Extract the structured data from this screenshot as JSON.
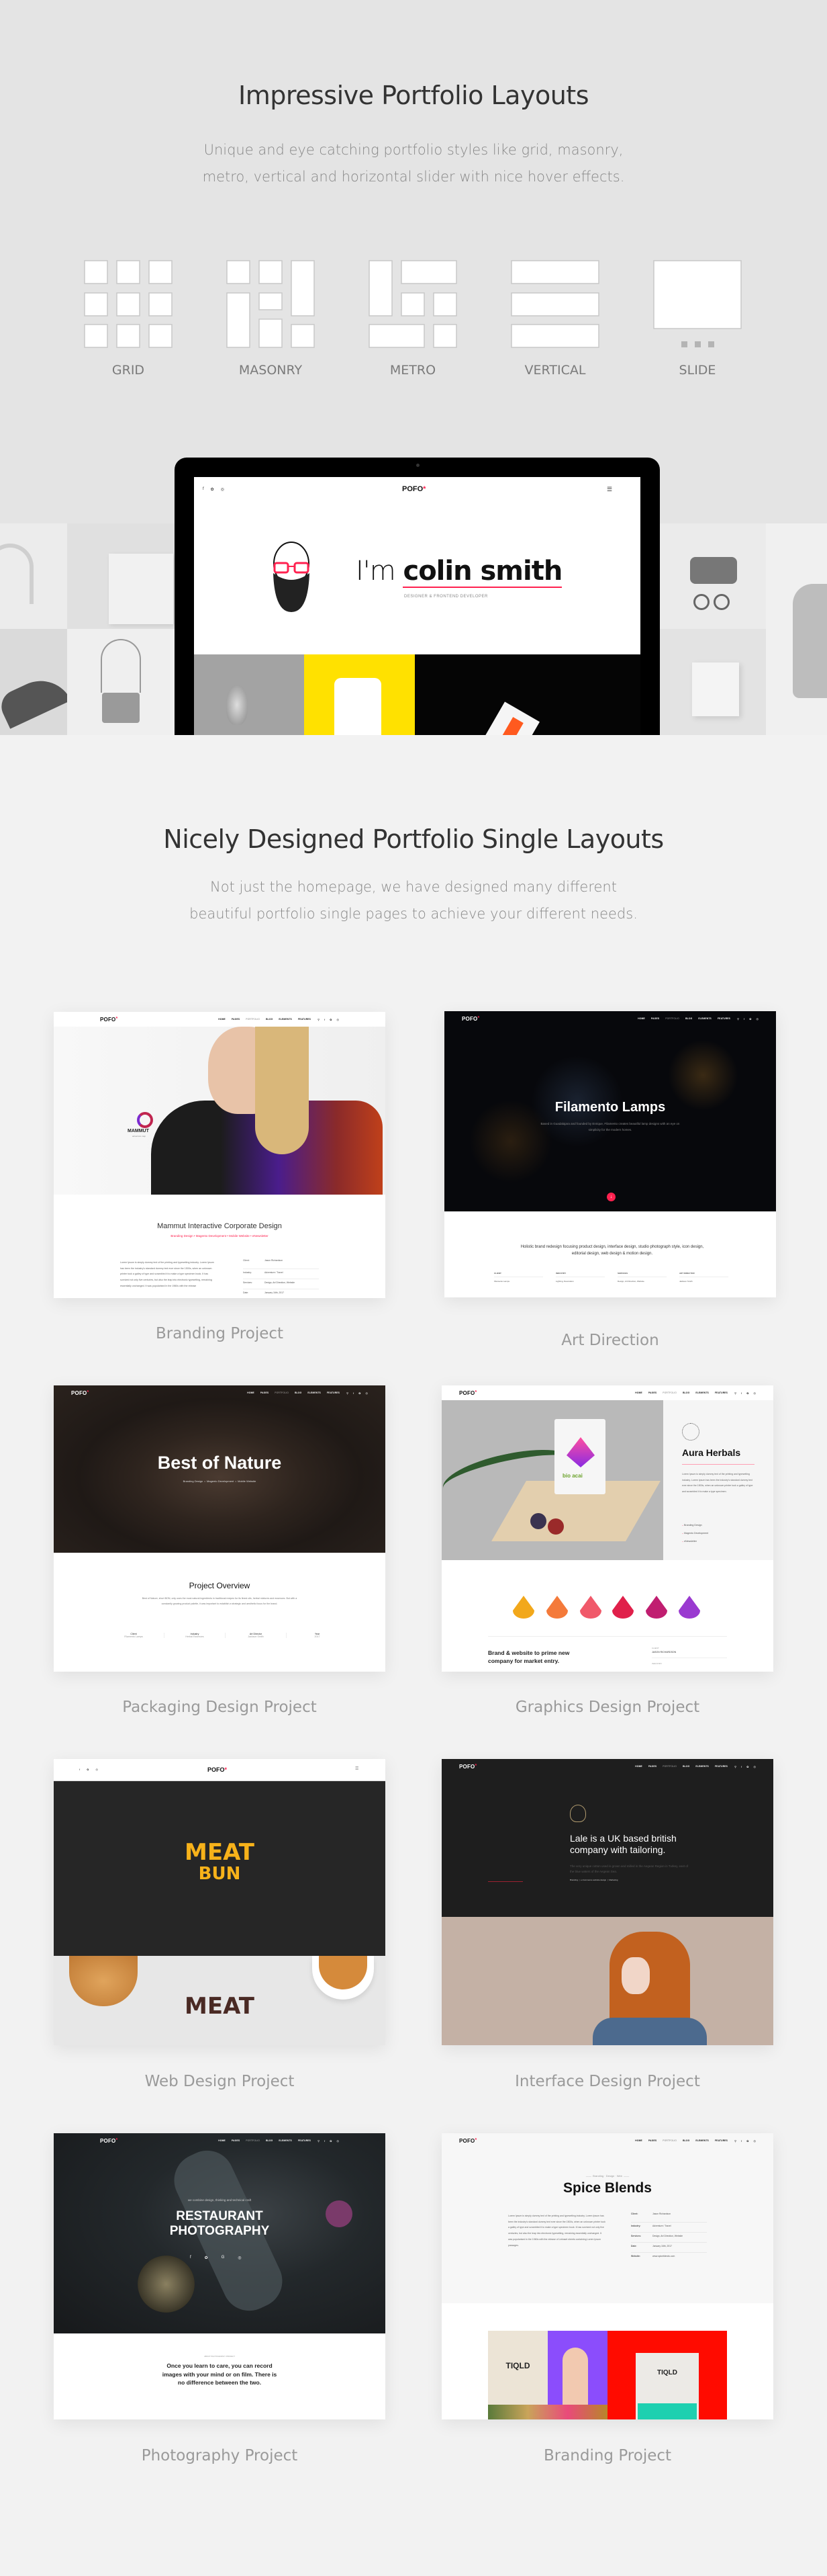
{
  "layouts": {
    "title": "Impressive Portfolio Layouts",
    "subtitle_lines": [
      "Unique and eye catching portfolio styles like grid, masonry,",
      "metro, vertical and horizontal slider with nice hover effects."
    ],
    "styles": [
      {
        "label": "GRID",
        "icon": "grid-layout-icon"
      },
      {
        "label": "MASONRY",
        "icon": "masonry-layout-icon"
      },
      {
        "label": "METRO",
        "icon": "metro-layout-icon"
      },
      {
        "label": "VERTICAL",
        "icon": "vertical-layout-icon"
      },
      {
        "label": "SLIDE",
        "icon": "slide-layout-icon"
      }
    ]
  },
  "showcase": {
    "logo": "POFO",
    "logo_mark": "*",
    "hero_prefix": "I'm",
    "hero_name": "colin smith",
    "hero_role": "DESIGNER & FRONTEND DEVELOPER",
    "social_icons": [
      "facebook-icon",
      "twitter-icon",
      "instagram-icon"
    ]
  },
  "singles": {
    "title": "Nicely Designed Portfolio Single Layouts",
    "subtitle_lines": [
      "Not just the homepage, we have designed many different",
      "beautiful portfolio single pages to achieve your different needs."
    ]
  },
  "nav": {
    "logo": "POFO",
    "logo_mark": "*",
    "items": [
      "HOME",
      "PAGES",
      "PORTFOLIO",
      "BLOG",
      "ELEMENTS",
      "FEATURES"
    ],
    "icons": [
      "search-icon",
      "facebook-icon",
      "twitter-icon",
      "instagram-icon"
    ]
  },
  "colors": {
    "accent": "#ff214f",
    "top_band": "#e4e4e4",
    "page_bg": "#f2f2f2"
  },
  "projects": [
    {
      "label": "Branding Project",
      "brand": "MAMMUT",
      "brand_tag": "adventure map",
      "title": "Mammut Interactive Corporate Design",
      "tags": [
        "Branding Design",
        "Magento Development",
        "Mobile Website",
        "eNewsletter"
      ],
      "body": "Lorem Ipsum is simply dummy text of the printing and typesetting industry. Lorem Ipsum has been the industry's standard dummy text ever since the 1500s, when an unknown printer took a galley of type and scrambled it to make a type specimen book. It has survived not only five centuries, but also the leap into electronic typesetting, remaining essentially unchanged. It was popularised in the 1960s with the release",
      "details": [
        {
          "k": "Client:",
          "v": "Jason Richardson"
        },
        {
          "k": "Industry:",
          "v": "Adventure / Travel"
        },
        {
          "k": "Services:",
          "v": "Design, Art Direction, Website"
        },
        {
          "k": "Date:",
          "v": "January 16th, 2017"
        }
      ]
    },
    {
      "label": "Art Direction",
      "title": "Filamento Lamps",
      "sub": "Based in Guadalajara and founded by Enrique, Filamento creates beautiful lamp designs with an eye on simplicity for the modern homes.",
      "intro": "Holistic brand redesign focusing product design, interface design, studio photograph style, icon design, editorial design, web design & motion design.",
      "details": [
        {
          "k": "CLIENT",
          "v": "Filamento Lamps"
        },
        {
          "k": "INDUSTRY",
          "v": "Lighting, Decoration"
        },
        {
          "k": "SERVICES",
          "v": "Design, Art Direction, Website"
        },
        {
          "k": "ART DIRECTOR",
          "v": "Jackson Smith"
        }
      ]
    },
    {
      "label": "Packaging Design Project",
      "title": "Best of Nature",
      "tags": [
        "Branding Design",
        "Magento Development",
        "Mobile Website"
      ],
      "overview_title": "Project Overview",
      "overview": "Best of Nature, short BON, only uses the most natural ingredients in traditional recipes for its finest oils, herbal mixtures and essences. But with a constantly growing product palette, it was important to establish a strategic and aesthetic focus for the brand.",
      "details": [
        {
          "k": "Client",
          "v": "Filamento Lamps"
        },
        {
          "k": "Industry",
          "v": "Herbal Essences"
        },
        {
          "k": "Art Director",
          "v": "Jackson Smith"
        },
        {
          "k": "Year",
          "v": "2017"
        }
      ]
    },
    {
      "label": "Graphics Design Project",
      "title": "Aura Herbals",
      "product": "bio acai",
      "body": "Lorem Ipsum is simply dummy text of the printing and typesetting industry. Lorem Ipsum has been the industry's standard dummy text ever since the 1500s, when an unknown printer took a galley of type and scrambled it to make a type specimen.",
      "list": [
        "Branding Design",
        "Magento Development",
        "eNewsletter"
      ],
      "heading": "Brand & website to prime new company for market entry.",
      "details": [
        {
          "k": "CLIENT",
          "v": "JASON RICHARDSON"
        },
        {
          "k": "INDUSTRY",
          "v": ""
        }
      ]
    },
    {
      "label": "Web Design Project",
      "logo_top": "MEAT",
      "logo_bottom": "BUN"
    },
    {
      "label": "Interface Design Project",
      "heading": "Lale is a UK based british company with tailoring.",
      "body": "The very unique cotton used is grown and milled in the Aegean Region in Turkey, east of the blue waters of the Aegean Sea.",
      "tags": [
        "Branding",
        "e-Commerce website design",
        "Marketing"
      ]
    },
    {
      "label": "Photography Project",
      "kicker": "we combine design, thinking and technical craft",
      "title_lines": [
        "RESTAURANT",
        "PHOTOGRAPHY"
      ],
      "about": "ABOUT PHOTOGRAPHY PROJECT",
      "quote": "Once you learn to care, you can record images with your mind or on film. There is no difference between the two."
    },
    {
      "label": "Branding Project",
      "tags": [
        "Branding",
        "Design",
        "Web"
      ],
      "title": "Spice Blends",
      "brand": "TIQLD",
      "body": "Lorem Ipsum is simply dummy text of the printing and typesetting industry. Lorem Ipsum has been the industry's standard dummy text ever since the 1500s, when an unknown printer took a galley of type and scrambled it to make a type specimen book. It has survived not only five centuries, but also the leap into electronic typesetting, remaining essentially unchanged. It was popularised in the 1960s with the release of Letraset sheets containing Lorem Ipsum passages.",
      "details": [
        {
          "k": "Client:",
          "v": "Jason Richardson"
        },
        {
          "k": "Industry:",
          "v": "Adventure / Travel"
        },
        {
          "k": "Services:",
          "v": "Design, Art Direction, Website"
        },
        {
          "k": "Date:",
          "v": "January 16th, 2017"
        },
        {
          "k": "Website:",
          "v": "www.spiceblends.com"
        }
      ]
    }
  ]
}
